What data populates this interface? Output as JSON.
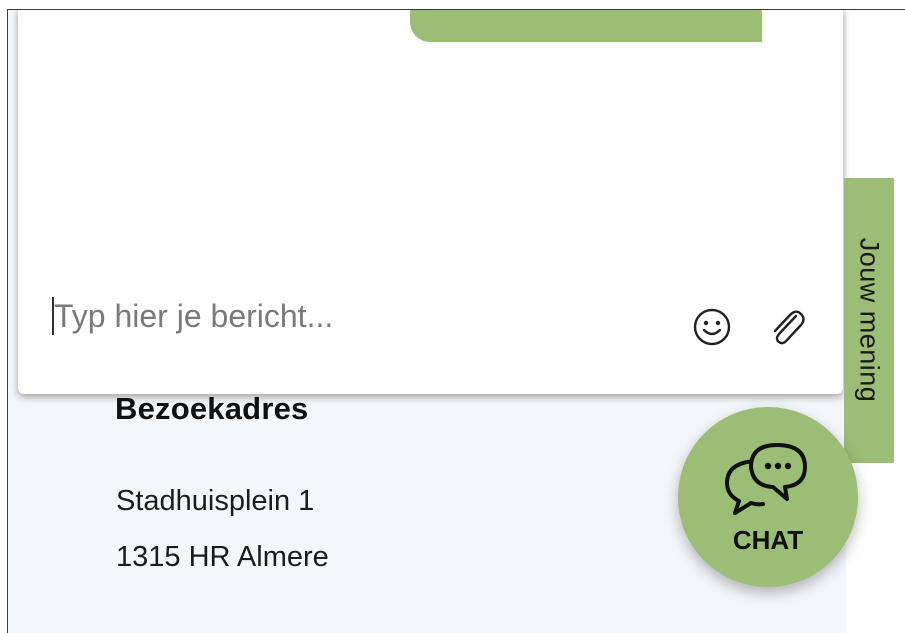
{
  "address": {
    "title": "Bezoekadres",
    "street": "Stadhuisplein 1",
    "city": "1315 HR  Almere"
  },
  "chat_window": {
    "input_placeholder": "Typ hier je bericht...",
    "input_value": "",
    "emoji_icon": "smiley-icon",
    "attach_icon": "paperclip-icon"
  },
  "feedback_tab": {
    "label": "Jouw mening"
  },
  "chat_button": {
    "label": "CHAT",
    "icon": "chat-bubbles-icon"
  },
  "colors": {
    "accent_green": "#9cbd75",
    "page_background": "#f4f7fa",
    "text_dark": "#111111",
    "placeholder_gray": "#7a7a7a"
  }
}
